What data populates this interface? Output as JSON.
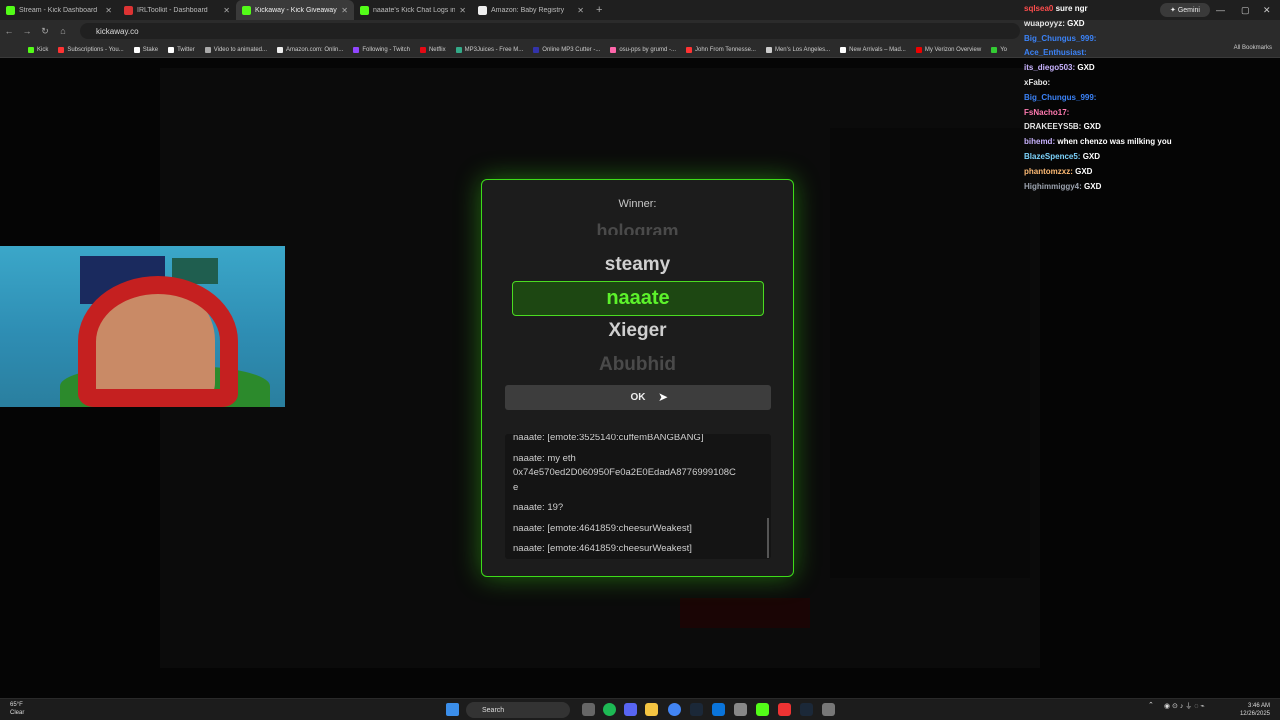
{
  "browser": {
    "tabs": [
      {
        "label": "Stream - Kick Dashboard",
        "color": "#53fc18"
      },
      {
        "label": "IRLToolkit - Dashboard",
        "color": "#d33"
      },
      {
        "label": "Kickaway - Kick Giveaway Tool",
        "color": "#53fc18"
      },
      {
        "label": "naaate's Kick Chat Logs in swe...",
        "color": "#53fc18"
      },
      {
        "label": "Amazon: Baby Registry",
        "color": "#eee"
      }
    ],
    "new_tab": "+",
    "gemini_label": "Gemini",
    "url": "kickaway.co",
    "bookmarks": [
      {
        "label": "Kick",
        "color": "#53fc18"
      },
      {
        "label": "Subscriptions - You...",
        "color": "#f33"
      },
      {
        "label": "Stake",
        "color": "#fff"
      },
      {
        "label": "Twitter",
        "color": "#fff"
      },
      {
        "label": "Video to animated...",
        "color": "#aaa"
      },
      {
        "label": "Amazon.com: Onlin...",
        "color": "#eee"
      },
      {
        "label": "Following - Twitch",
        "color": "#9146ff"
      },
      {
        "label": "Netflix",
        "color": "#e50914"
      },
      {
        "label": "MP3Juices - Free M...",
        "color": "#3a8"
      },
      {
        "label": "Online MP3 Cutter -...",
        "color": "#33a"
      },
      {
        "label": "osu-pps by grumd -...",
        "color": "#f6a"
      },
      {
        "label": "John From Tennesse...",
        "color": "#f33"
      },
      {
        "label": "Men's Los Angeles...",
        "color": "#ccc"
      },
      {
        "label": "New Arrivals – Mad...",
        "color": "#fff"
      },
      {
        "label": "My Verizon Overview",
        "color": "#e00"
      },
      {
        "label": "Yo",
        "color": "#3c3"
      }
    ],
    "all_bookmarks": "All Bookmarks"
  },
  "modal": {
    "winner_label": "Winner:",
    "names": [
      "hologram",
      "steamy",
      "naaate",
      "Xieger",
      "Abubhid"
    ],
    "selected": "naaate",
    "ok_label": "OK",
    "chat": [
      "naaate: [emote:3525140:cuffemBANGBANG]",
      "naaate: my eth",
      "0x74e570ed2D060950Fe0a2E0EdadA8776999108C",
      "e",
      "naaate: 19?",
      "naaate: [emote:4641859:cheesurWeakest]",
      "naaate: [emote:4641859:cheesurWeakest]"
    ]
  },
  "stream_chat": [
    {
      "user": "sqlsea0",
      "msg": "sure ngr",
      "color": "#ff4d4d"
    },
    {
      "user": "wuapoyyz:",
      "msg": "GXD",
      "color": "#e5e5e5"
    },
    {
      "user": "Big_Chungus_999:",
      "msg": "",
      "color": "#3b82f6"
    },
    {
      "user": "Ace_Enthusiast:",
      "msg": "",
      "color": "#3b82f6"
    },
    {
      "user": "its_diego503:",
      "msg": "GXD",
      "color": "#c9b3ff"
    },
    {
      "user": "xFabo:",
      "msg": "",
      "color": "#e5e5e5"
    },
    {
      "user": "Big_Chungus_999:",
      "msg": "",
      "color": "#3b82f6"
    },
    {
      "user": "FsNacho17:",
      "msg": "",
      "color": "#ff7ab0"
    },
    {
      "user": "DRAKEEYS5B:",
      "msg": "GXD",
      "color": "#e5e5e5"
    },
    {
      "user": "bihemd:",
      "msg": "when chenzo was milking you",
      "color": "#c9b3ff"
    },
    {
      "user": "BlazeSpence5:",
      "msg": "GXD",
      "color": "#7dd3fc"
    },
    {
      "user": "phantomzxz:",
      "msg": "GXD",
      "color": "#fdba74"
    },
    {
      "user": "Highimmiggy4:",
      "msg": "GXD",
      "color": "#9ca3af"
    }
  ],
  "taskbar": {
    "weather_temp": "65°F",
    "weather_cond": "Clear",
    "search_label": "Search",
    "time": "3:46 AM",
    "date": "12/26/2025"
  },
  "colors": {
    "accent": "#53fc18",
    "modal_border": "#3ddc19"
  }
}
